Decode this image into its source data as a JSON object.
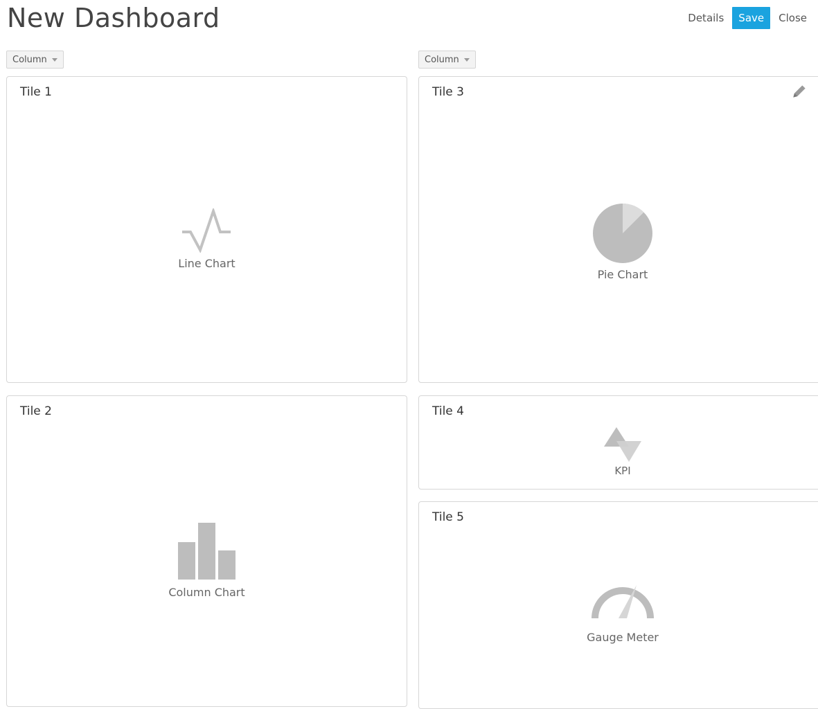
{
  "header": {
    "title": "New Dashboard",
    "details_label": "Details",
    "save_label": "Save",
    "close_label": "Close"
  },
  "columns": [
    {
      "label": "Column"
    },
    {
      "label": "Column"
    }
  ],
  "tiles": [
    {
      "title": "Tile 1",
      "label": "Line Chart",
      "icon": "line-chart-icon"
    },
    {
      "title": "Tile 2",
      "label": "Column Chart",
      "icon": "column-chart-icon"
    },
    {
      "title": "Tile 3",
      "label": "Pie Chart",
      "icon": "pie-chart-icon"
    },
    {
      "title": "Tile 4",
      "label": "KPI",
      "icon": "kpi-icon"
    },
    {
      "title": "Tile 5",
      "label": "Gauge Meter",
      "icon": "gauge-meter-icon"
    }
  ],
  "colors": {
    "accent": "#1aa3df",
    "icon_gray": "#bdbdbd",
    "icon_light": "#dcdcdc",
    "border": "#d6d6d6"
  }
}
